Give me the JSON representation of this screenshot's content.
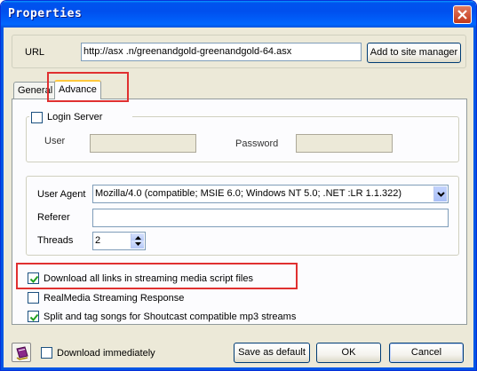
{
  "window": {
    "title": "Properties"
  },
  "url_row": {
    "label": "URL",
    "value": "http://asx                        .n/greenandgold-greenandgold-64.asx",
    "add_button": "Add to site manager"
  },
  "tabs": [
    {
      "label": "General",
      "active": false
    },
    {
      "label": "Advance",
      "active": true
    }
  ],
  "login": {
    "checkbox_label": "Login Server",
    "checked": false,
    "user_label": "User",
    "user_value": "",
    "password_label": "Password",
    "password_value": ""
  },
  "request": {
    "user_agent_label": "User Agent",
    "user_agent_value": "Mozilla/4.0 (compatible; MSIE 6.0; Windows NT 5.0; .NET :LR 1.1.322)",
    "referer_label": "Referer",
    "referer_value": "",
    "threads_label": "Threads",
    "threads_value": "2"
  },
  "options": [
    {
      "label": "Download all links in streaming media script files",
      "checked": true
    },
    {
      "label": "RealMedia Streaming Response",
      "checked": false
    },
    {
      "label": "Split and tag songs for Shoutcast compatible mp3 streams",
      "checked": true
    }
  ],
  "footer": {
    "download_immediately_label": "Download immediately",
    "download_immediately_checked": false,
    "save_default_button": "Save as default",
    "ok_button": "OK",
    "cancel_button": "Cancel"
  },
  "colors": {
    "titlebar": "#0055e5",
    "window_bg": "#ece9d8",
    "highlight": "#e03030"
  }
}
